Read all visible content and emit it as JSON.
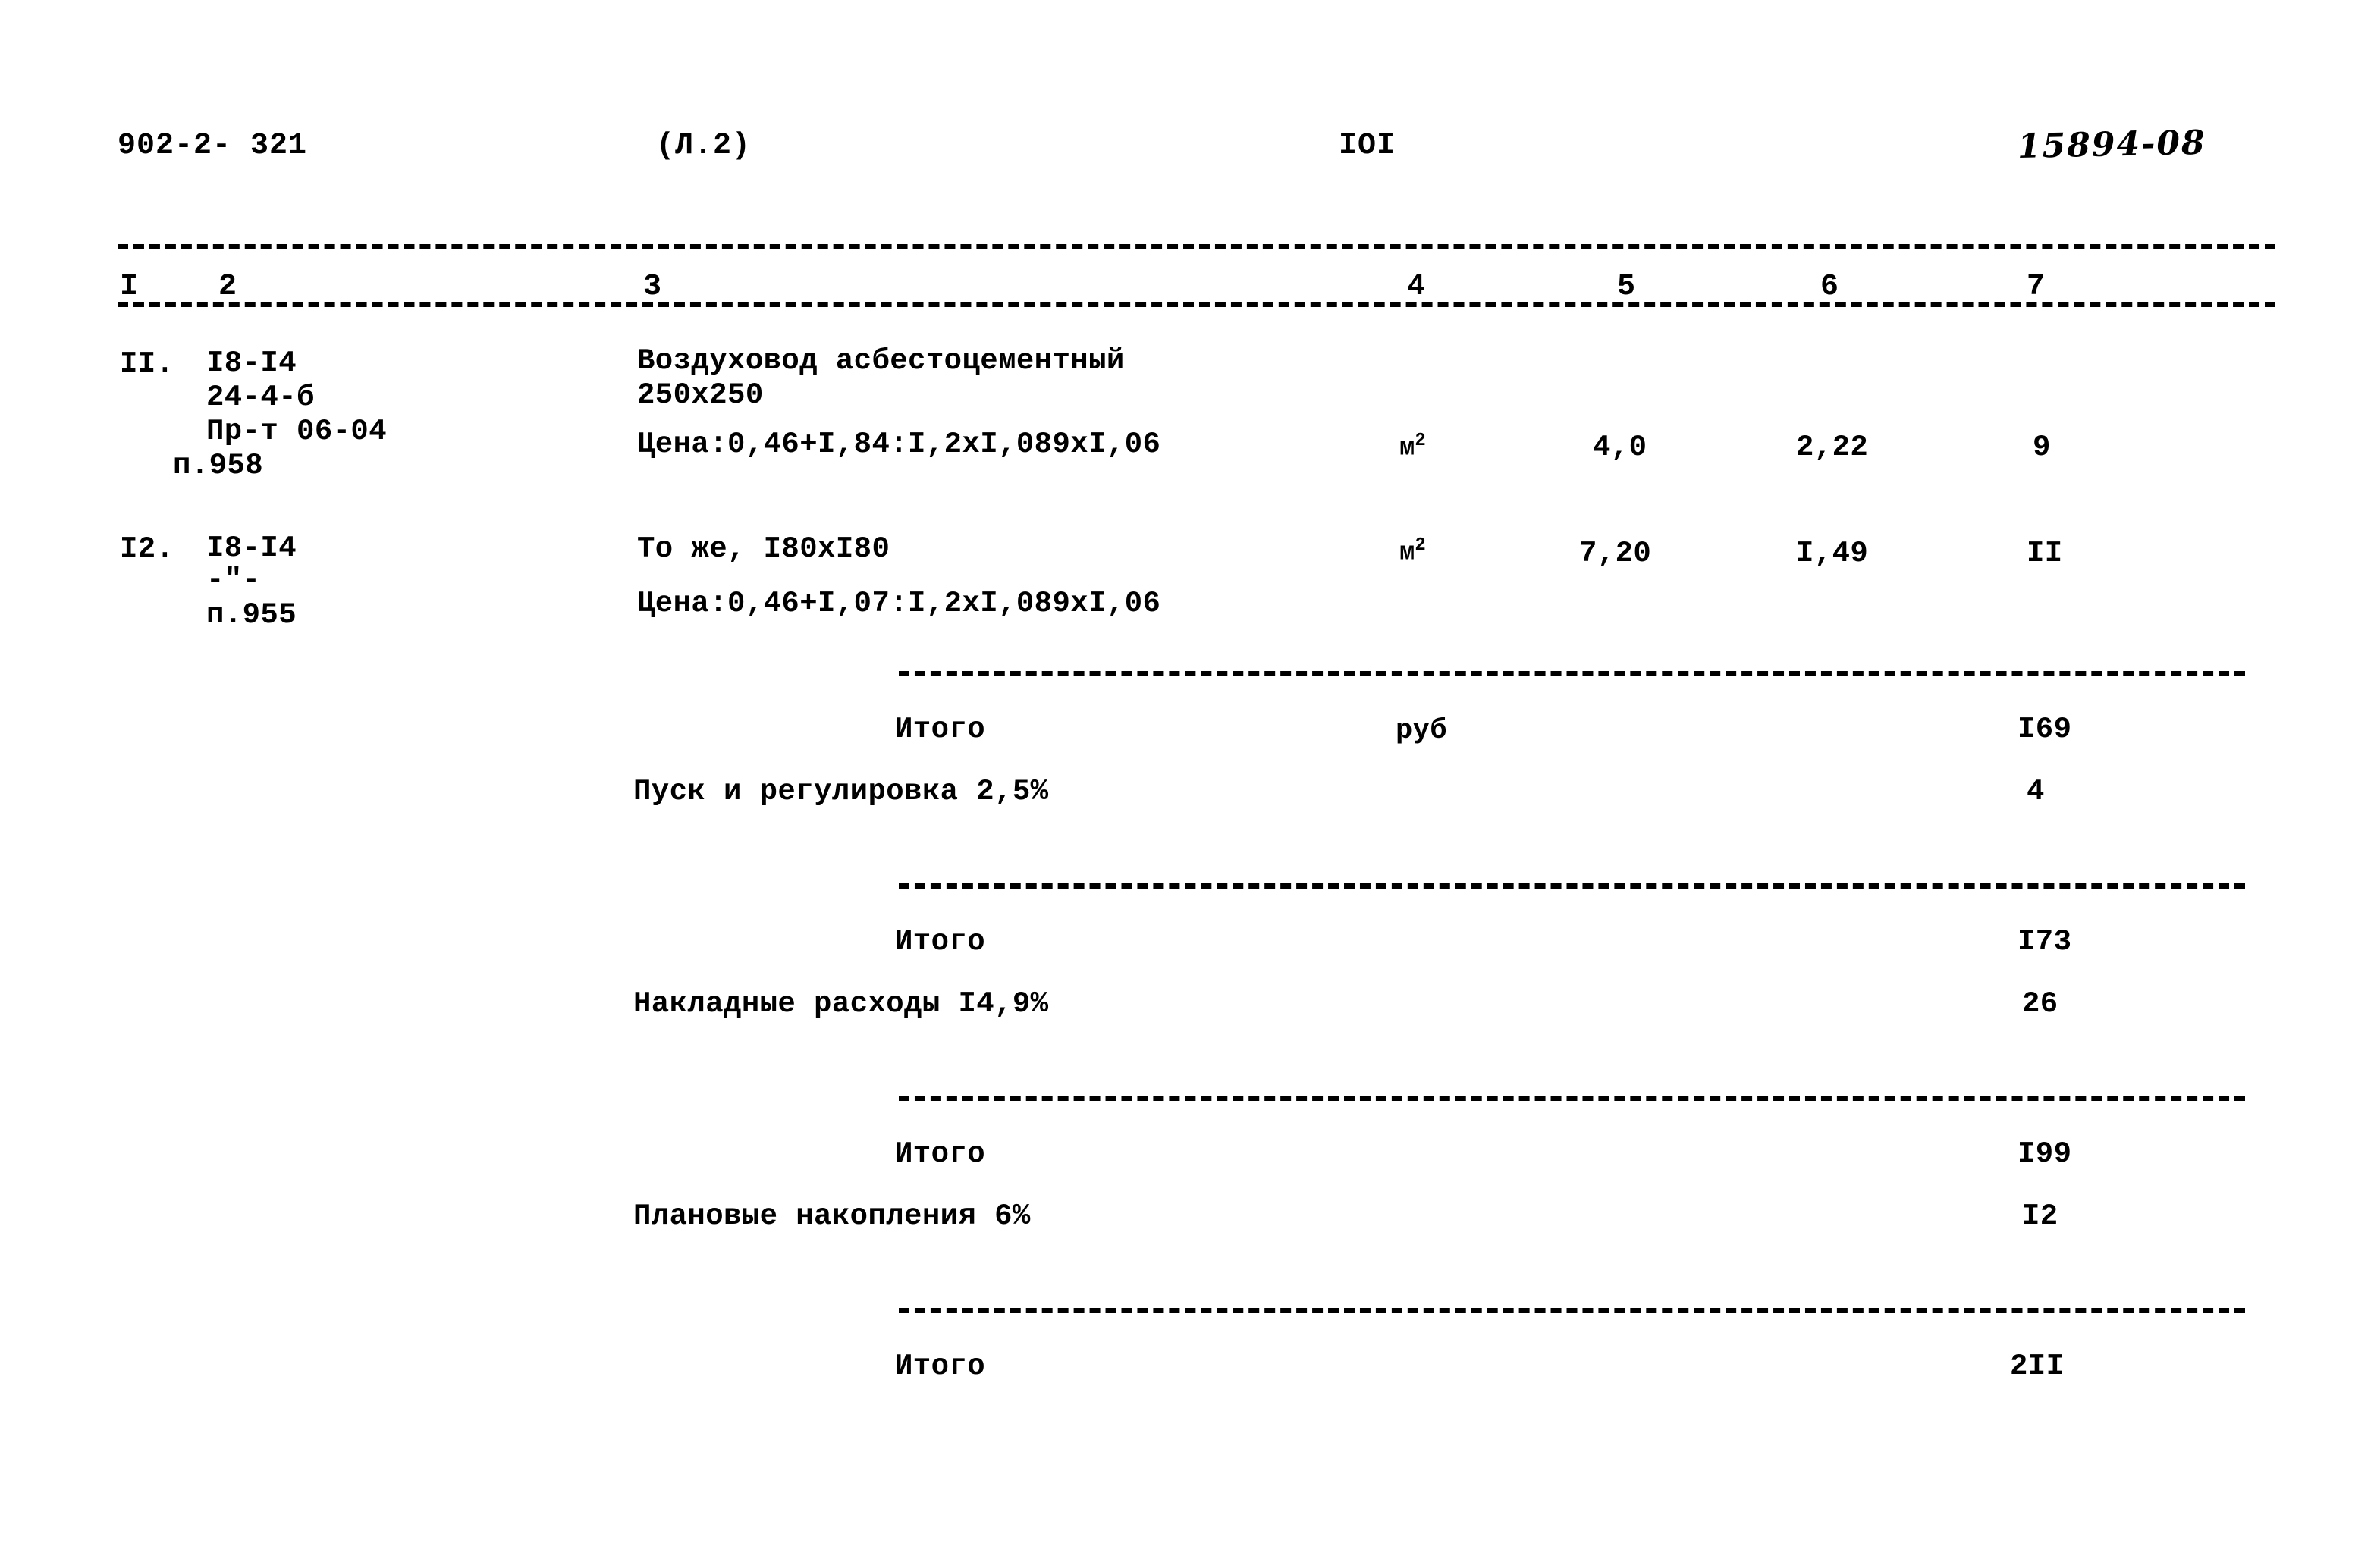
{
  "header": {
    "doc_code": "902-2- 321",
    "section": "(Л.2)",
    "page_number": "IOI",
    "archive_code": "15894-08"
  },
  "table": {
    "column_numbers": [
      "I",
      "2",
      "3",
      "4",
      "5",
      "6",
      "7"
    ],
    "rows": [
      {
        "no": "II.",
        "ref_lines": [
          "I8-I4",
          "24-4-б",
          "Пр-т 06-04",
          "п.958"
        ],
        "desc_lines": [
          "Воздуховод асбестоцементный",
          "250х250"
        ],
        "price_line": "Цена:0,46+I,84:I,2хI,089хI,06",
        "unit": "м",
        "unit_sup": "2",
        "qty": "4,0",
        "rate": "2,22",
        "total": "9"
      },
      {
        "no": "I2.",
        "ref_lines": [
          "I8-I4",
          "-\"-",
          "п.955"
        ],
        "desc_lines": [
          "То же, I80хI80"
        ],
        "price_line": "Цена:0,46+I,07:I,2хI,089хI,06",
        "unit": "м",
        "unit_sup": "2",
        "qty": "7,20",
        "rate": "I,49",
        "total": "II"
      }
    ],
    "summary": [
      {
        "label": "Итого",
        "unit": "руб",
        "value": "I69",
        "indent": "center"
      },
      {
        "label": "Пуск и регулировка 2,5%",
        "unit": "",
        "value": "4",
        "indent": "left"
      },
      {
        "label": "Итого",
        "unit": "",
        "value": "I73",
        "indent": "center"
      },
      {
        "label": "Накладные расходы I4,9%",
        "unit": "",
        "value": "26",
        "indent": "left"
      },
      {
        "label": "Итого",
        "unit": "",
        "value": "I99",
        "indent": "center"
      },
      {
        "label": "Плановые накопления 6%",
        "unit": "",
        "value": "I2",
        "indent": "left"
      },
      {
        "label": "Итого",
        "unit": "",
        "value": "2II",
        "indent": "center"
      }
    ]
  }
}
